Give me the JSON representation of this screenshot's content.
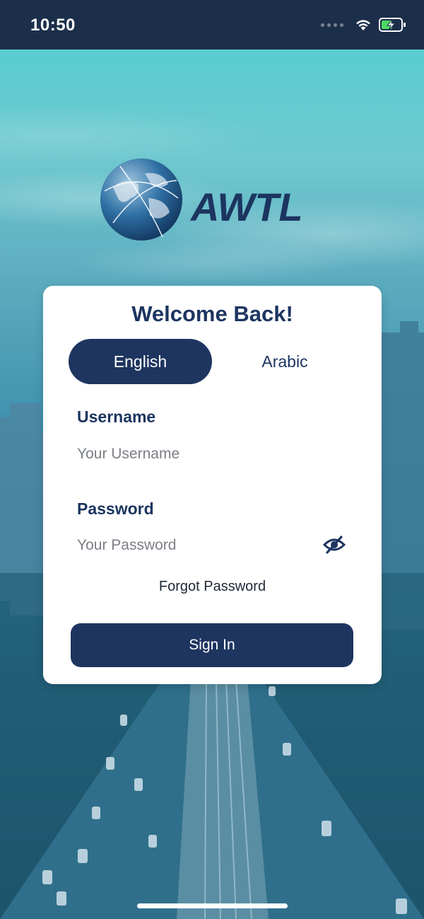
{
  "status_bar": {
    "time": "10:50",
    "icons": [
      "signal-dots-icon",
      "wifi-icon",
      "battery-charging-icon"
    ]
  },
  "logo": {
    "brand_text": "AWTL"
  },
  "login": {
    "title": "Welcome Back!",
    "languages": [
      {
        "label": "English",
        "selected": true
      },
      {
        "label": "Arabic",
        "selected": false
      }
    ],
    "username": {
      "label": "Username",
      "placeholder": "Your Username",
      "value": ""
    },
    "password": {
      "label": "Password",
      "placeholder": "Your Password",
      "value": "",
      "visibility_icon": "eye-slash-icon"
    },
    "forgot_label": "Forgot Password",
    "sign_in_label": "Sign In"
  },
  "colors": {
    "navy": "#1e3560",
    "status_bar": "#1c2f4a",
    "card": "#ffffff",
    "sky": "#58cdd0"
  }
}
